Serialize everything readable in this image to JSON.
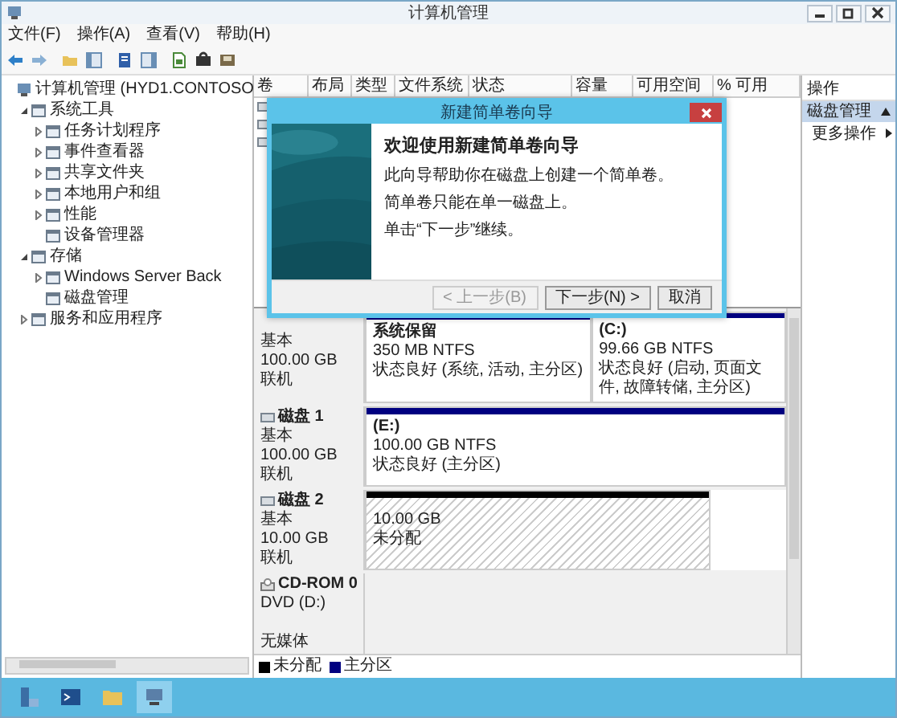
{
  "window": {
    "title": "计算机管理"
  },
  "menu": [
    "文件(F)",
    "操作(A)",
    "查看(V)",
    "帮助(H)"
  ],
  "tree": [
    {
      "label": "计算机管理 (HYD1.CONTOSO",
      "children": [
        {
          "label": "系统工具",
          "expanded": true,
          "children": [
            {
              "label": "任务计划程序",
              "expanded": false
            },
            {
              "label": "事件查看器",
              "expanded": false
            },
            {
              "label": "共享文件夹",
              "expanded": false
            },
            {
              "label": "本地用户和组",
              "expanded": false
            },
            {
              "label": "性能",
              "expanded": false
            },
            {
              "label": "设备管理器"
            }
          ]
        },
        {
          "label": "存储",
          "expanded": true,
          "children": [
            {
              "label": "Windows Server Back",
              "expanded": false
            },
            {
              "label": "磁盘管理"
            }
          ]
        },
        {
          "label": "服务和应用程序",
          "expanded": false
        }
      ]
    }
  ],
  "volume_list": {
    "columns": [
      "卷",
      "布局",
      "类型",
      "文件系统",
      "状态",
      "容量",
      "可用空间",
      "% 可用"
    ],
    "rows": [
      {
        "kind": "volume"
      },
      {
        "kind": "volume"
      },
      {
        "kind": "volume"
      }
    ]
  },
  "dialog": {
    "title": "新建简单卷向导",
    "heading": "欢迎使用新建简单卷向导",
    "paragraphs": [
      "此向导帮助你在磁盘上创建一个简单卷。",
      "简单卷只能在单一磁盘上。",
      "单击“下一步”继续。"
    ],
    "buttons": [
      {
        "label": "< 上一步(B)",
        "disabled": true
      },
      {
        "label": "下一步(N) >",
        "disabled": false
      },
      {
        "label": "取消",
        "disabled": false
      }
    ]
  },
  "disks": [
    {
      "kind": "disk",
      "type": "基本",
      "size": "100.00 GB",
      "status": "联机",
      "partitions": [
        {
          "kind": "primary",
          "name": "系统保留",
          "detail": "350 MB NTFS",
          "health": "状态良好 (系统, 活动, 主分区)"
        },
        {
          "kind": "primary",
          "name": "(C:)",
          "detail": "99.66 GB NTFS",
          "health": "状态良好 (启动, 页面文件, 故障转储, 主分区)"
        }
      ]
    },
    {
      "kind": "disk",
      "name": "磁盘 1",
      "type": "基本",
      "size": "100.00 GB",
      "status": "联机",
      "partitions": [
        {
          "kind": "primary",
          "name": "(E:)",
          "detail": "100.00 GB NTFS",
          "health": "状态良好 (主分区)"
        }
      ]
    },
    {
      "kind": "disk",
      "name": "磁盘 2",
      "type": "基本",
      "size": "10.00 GB",
      "status": "联机",
      "partitions": [
        {
          "kind": "unallocated",
          "detail": "10.00 GB",
          "health": "未分配"
        }
      ]
    },
    {
      "kind": "cdrom",
      "name": "CD-ROM 0",
      "type": "DVD (D:)",
      "status": "无媒体"
    }
  ],
  "legend": [
    {
      "label": "未分配",
      "color": "#000000"
    },
    {
      "label": "主分区",
      "color": "#000080"
    }
  ],
  "actions": {
    "title": "操作",
    "sections": [
      {
        "title": "磁盘管理",
        "expanded": true,
        "items": [
          "更多操作"
        ]
      }
    ]
  }
}
